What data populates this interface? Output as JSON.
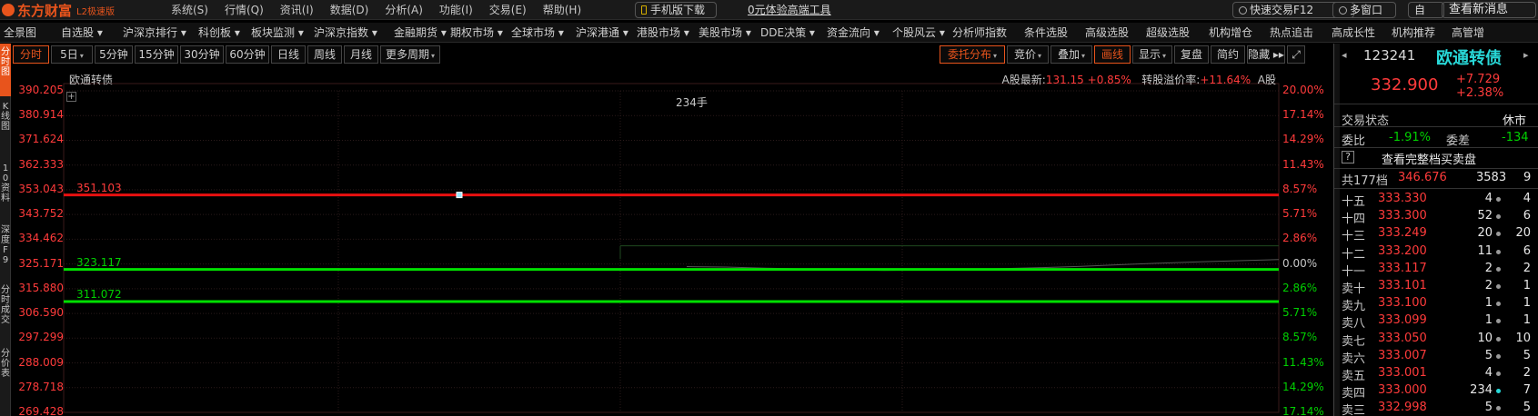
{
  "app": {
    "logo_text": "东方财富",
    "logo_version": "L2极速版",
    "menu": [
      "系统(S)",
      "行情(Q)",
      "资讯(I)",
      "数据(D)",
      "分析(A)",
      "功能(I)",
      "交易(E)",
      "帮助(H)"
    ],
    "mobile_btn": "手机版下载",
    "pro_link": "0元体验高端工具",
    "fast_trade": "快速交易F12",
    "multi_window": "多窗口",
    "self_label": "自",
    "news_btn": "查看新消息"
  },
  "nav": {
    "items": [
      "全景图",
      "自选股 ▾",
      "沪深京排行 ▾",
      "科创板 ▾",
      "板块监测 ▾",
      "沪深京指数 ▾",
      "金融期货 ▾",
      "期权市场 ▾",
      "全球市场 ▾",
      "沪深港通 ▾",
      "港股市场 ▾",
      "美股市场 ▾",
      "DDE决策 ▾",
      "资金流向 ▾",
      "个股风云 ▾",
      "分析师指数",
      "条件选股",
      "高级选股",
      "超级选股",
      "机构增仓",
      "热点追击",
      "高成长性",
      "机构推荐",
      "高管增"
    ]
  },
  "left_strip": {
    "items": [
      "分时图",
      "K线图",
      "10资料",
      "深度F9",
      "分时成交",
      "分价表"
    ]
  },
  "periods": {
    "items": [
      {
        "label": "分时",
        "active": true
      },
      {
        "label": "5日",
        "caret": true
      },
      {
        "label": "5分钟"
      },
      {
        "label": "15分钟"
      },
      {
        "label": "30分钟"
      },
      {
        "label": "60分钟"
      },
      {
        "label": "日线"
      },
      {
        "label": "周线"
      },
      {
        "label": "月线"
      },
      {
        "label": "更多周期",
        "caret": true
      }
    ]
  },
  "tools": {
    "items": [
      {
        "label": "委托分布",
        "caret": true,
        "orange": true
      },
      {
        "label": "竞价",
        "caret": true
      },
      {
        "label": "叠加",
        "caret": true
      },
      {
        "label": "画线",
        "orange": true
      },
      {
        "label": "显示",
        "caret": true
      },
      {
        "label": "复盘"
      },
      {
        "label": "简约"
      },
      {
        "label": "隐藏 ▸▸"
      },
      {
        "label": "⤢"
      }
    ]
  },
  "chart": {
    "title": "欧通转债",
    "info_prefix": "A股最新:",
    "info_price": "131.15",
    "info_pct": "+0.85%",
    "info_premium_label": "转股溢价率:",
    "info_premium": "+11.64%",
    "info_suffix": "A股",
    "volume_label": "234手",
    "plus": "+",
    "line_labels": {
      "red": "351.103",
      "green_mid": "323.117",
      "green_low": "311.072"
    }
  },
  "chart_data": {
    "type": "line",
    "title": "欧通转债",
    "prev_close": 323.117,
    "ylim": [
      269.428,
      390.205
    ],
    "price_ticks": [
      "390.205",
      "380.914",
      "371.624",
      "362.333",
      "353.043",
      "343.752",
      "334.462",
      "325.171",
      "315.880",
      "306.590",
      "297.299",
      "288.009",
      "278.718",
      "269.428"
    ],
    "pct_ticks": [
      "20.00%",
      "17.14%",
      "14.29%",
      "11.43%",
      "8.57%",
      "5.71%",
      "2.86%",
      "0.00%",
      "2.86%",
      "5.71%",
      "8.57%",
      "11.43%",
      "14.29%",
      "17.14%"
    ],
    "horizontal_lines": [
      {
        "value": 351.103,
        "color": "#e81010"
      },
      {
        "value": 323.117,
        "color": "#00e000"
      },
      {
        "value": 311.072,
        "color": "#00e000"
      }
    ],
    "series": [
      {
        "values": [
          324.2,
          324.0,
          323.6,
          323.3,
          323.0,
          322.8,
          322.9,
          323.1,
          323.4,
          323.8,
          324.3,
          324.9,
          325.5,
          326.0,
          326.4,
          326.8
        ]
      }
    ],
    "grid": true
  },
  "quote": {
    "code": "123241",
    "name": "欧通转债",
    "price": "332.900",
    "change": "+7.729",
    "change_pct": "+2.38%",
    "status_label": "交易状态",
    "status_value": "休市",
    "wb_label": "委比",
    "wb_value": "-1.91%",
    "wc_label": "委差",
    "wc_value": "-134",
    "full_book": "查看完整档买卖盘",
    "help": "?",
    "prev": "◂",
    "next": "▸",
    "total_label": "共177档",
    "total_price": "346.676",
    "total_vol": "3583",
    "total_cnt": "9"
  },
  "order_book": [
    {
      "level": "十五",
      "price": "333.330",
      "vol": "4",
      "cnt": "4"
    },
    {
      "level": "十四",
      "price": "333.300",
      "vol": "52",
      "cnt": "6"
    },
    {
      "level": "十三",
      "price": "333.249",
      "vol": "20",
      "cnt": "20"
    },
    {
      "level": "十二",
      "price": "333.200",
      "vol": "11",
      "cnt": "6"
    },
    {
      "level": "十一",
      "price": "333.117",
      "vol": "2",
      "cnt": "2"
    },
    {
      "level": "卖十",
      "price": "333.101",
      "vol": "2",
      "cnt": "1"
    },
    {
      "level": "卖九",
      "price": "333.100",
      "vol": "1",
      "cnt": "1"
    },
    {
      "level": "卖八",
      "price": "333.099",
      "vol": "1",
      "cnt": "1"
    },
    {
      "level": "卖七",
      "price": "333.050",
      "vol": "10",
      "cnt": "10"
    },
    {
      "level": "卖六",
      "price": "333.007",
      "vol": "5",
      "cnt": "5"
    },
    {
      "level": "卖五",
      "price": "333.001",
      "vol": "4",
      "cnt": "2"
    },
    {
      "level": "卖四",
      "price": "333.000",
      "vol": "234",
      "cnt": "7",
      "highlight": true
    },
    {
      "level": "卖三",
      "price": "332.998",
      "vol": "5",
      "cnt": "5"
    }
  ]
}
